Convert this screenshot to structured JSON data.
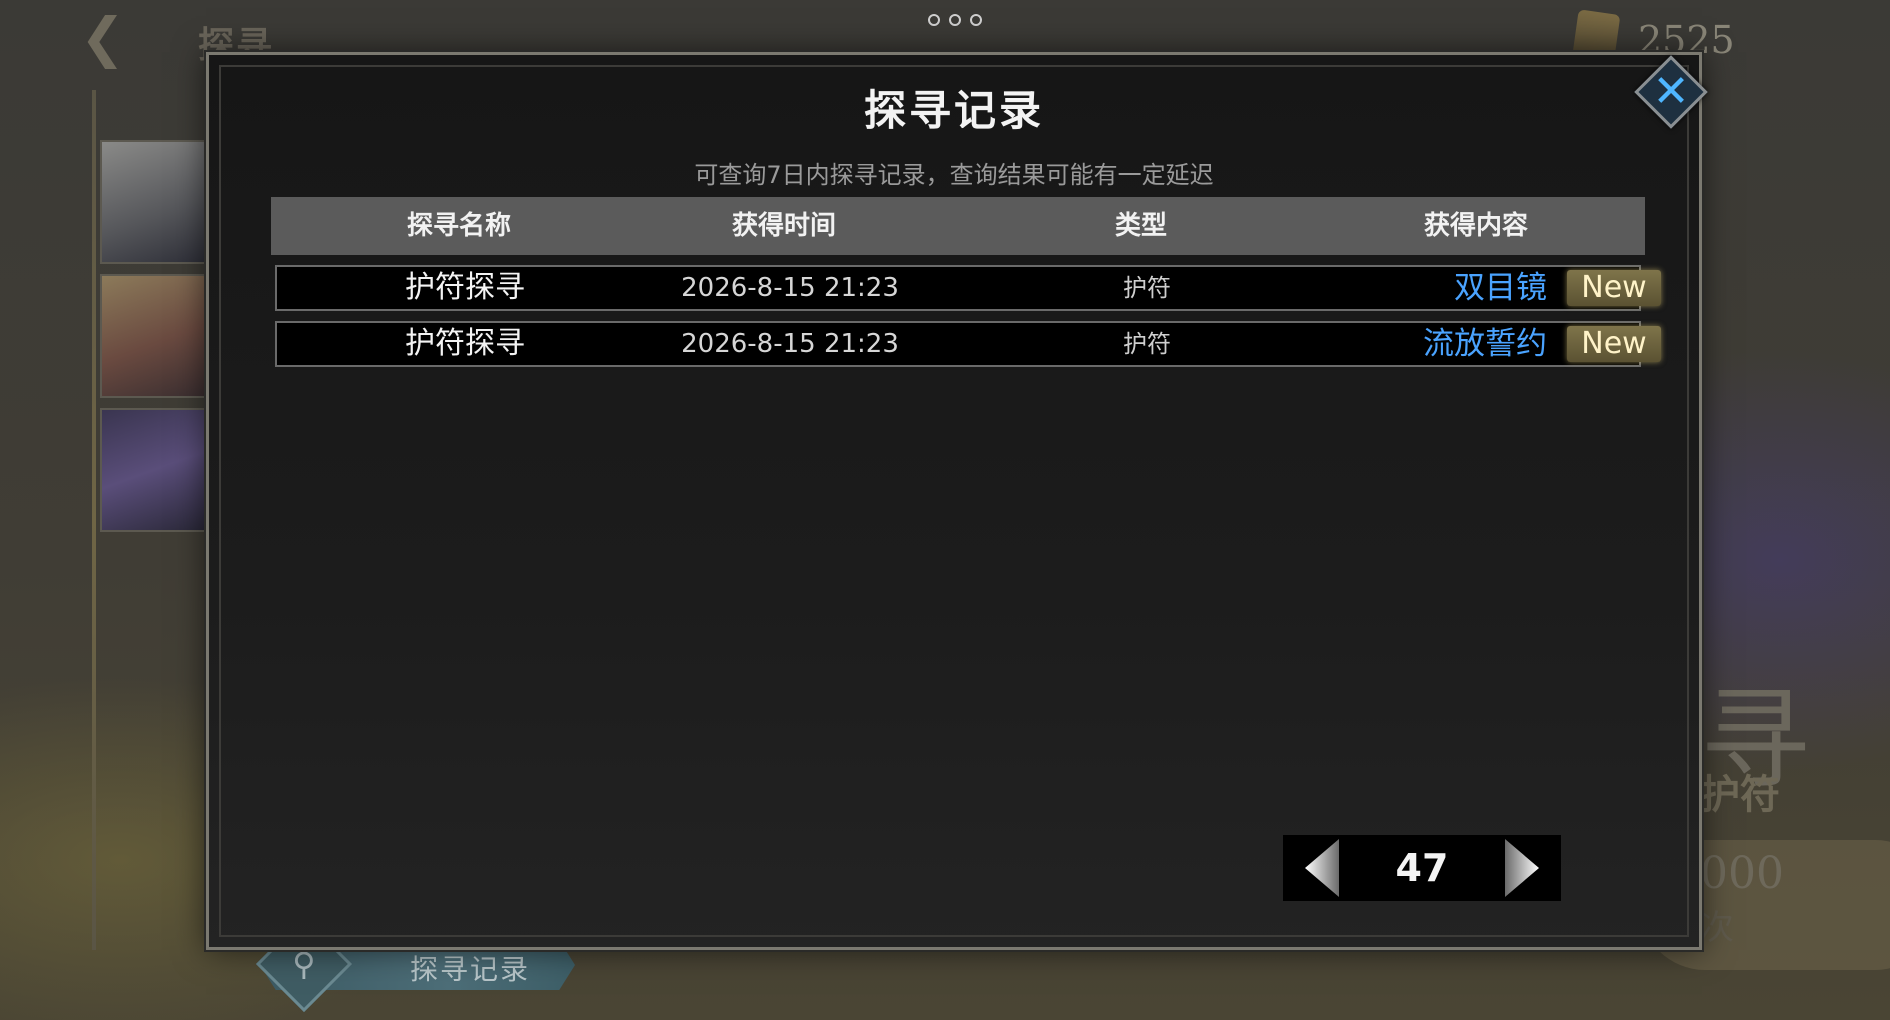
{
  "background": {
    "title": "探寻",
    "currency_value": "2525",
    "big_char": "寻",
    "sub_label": "护符",
    "cost_value": "000",
    "cost_unit": "次",
    "record_button_label": "探寻记录"
  },
  "modal": {
    "title": "探寻记录",
    "subtitle": "可查询7日内探寻记录，查询结果可能有一定延迟",
    "columns": [
      "探寻名称",
      "获得时间",
      "类型",
      "获得内容"
    ],
    "rows": [
      {
        "name": "护符探寻",
        "time": "2026-8-15 21:23",
        "type": "护符",
        "reward": "双目镜",
        "badge": "New"
      },
      {
        "name": "护符探寻",
        "time": "2026-8-15 21:23",
        "type": "护符",
        "reward": "流放誓约",
        "badge": "New"
      }
    ],
    "page": "47",
    "close_icon": "close-icon",
    "accent_color": "#4aa3ff"
  }
}
